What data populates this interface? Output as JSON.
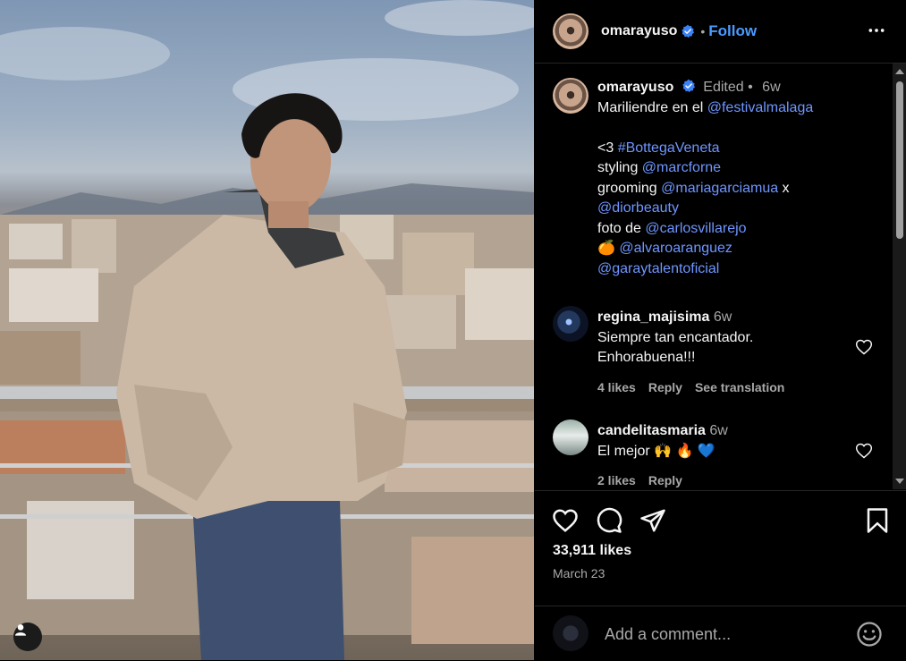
{
  "post": {
    "username": "omarayuso",
    "follow_label": "Follow",
    "separator": "•"
  },
  "caption": {
    "username": "omarayuso",
    "edited": "Edited",
    "bullet": "•",
    "age": "6w",
    "lines": [
      {
        "text": "Mariliendre en el ",
        "link": "@festivalmalaga"
      },
      {
        "text": "",
        "link": ""
      },
      {
        "text": "<3 ",
        "link": "#BottegaVeneta"
      },
      {
        "text": "styling ",
        "link": "@marcforne"
      },
      {
        "text": "grooming ",
        "link": "@mariagarciamua",
        "after": " x"
      },
      {
        "text": "",
        "link": "@diorbeauty"
      },
      {
        "text": "foto de ",
        "link": "@carlosvillarejo"
      },
      {
        "text": "🍊 ",
        "link": "@alvaroaranguez"
      },
      {
        "text": "",
        "link": "@garaytalentoficial"
      }
    ]
  },
  "comments": [
    {
      "username": "regina_majisima",
      "age": "6w",
      "text_lines": [
        "Siempre tan encantador.",
        "Enhorabuena!!!"
      ],
      "likes": "4 likes",
      "reply": "Reply",
      "translate": "See translation"
    },
    {
      "username": "candelitasmaria",
      "age": "6w",
      "text_lines": [
        "El mejor 🙌 🔥 💙"
      ],
      "likes": "2 likes",
      "reply": "Reply"
    }
  ],
  "footer": {
    "likes": "33,911 likes",
    "date": "March 23",
    "add_comment_placeholder": "Add a comment..."
  },
  "icons": {
    "verified": "verified-badge-icon",
    "more": "more-options-icon",
    "like": "heart-icon",
    "comment": "comment-icon",
    "share": "share-icon",
    "save": "bookmark-icon",
    "emoji": "emoji-icon",
    "user": "user-icon"
  },
  "colors": {
    "link": "#6f96ff",
    "follow": "#4a9bff",
    "verified": "#3b82f6",
    "secondary_text": "#a8a8a8"
  }
}
